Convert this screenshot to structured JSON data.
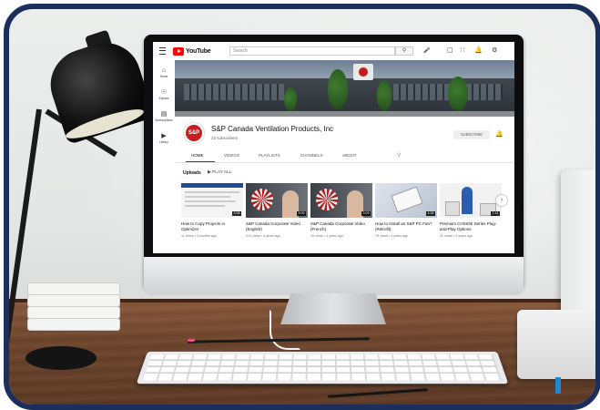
{
  "scene": {
    "frame_color": "#1c2f5c",
    "desk_color": "#6e452c"
  },
  "youtube": {
    "logo_text": "YouTube",
    "search_placeholder": "Search",
    "sidebar": [
      {
        "icon": "home-icon",
        "label": "Home"
      },
      {
        "icon": "explore-icon",
        "label": "Explore"
      },
      {
        "icon": "subscriptions-icon",
        "label": "Subscriptions"
      },
      {
        "icon": "library-icon",
        "label": "Library"
      }
    ],
    "channel": {
      "logo_text": "S&P",
      "name": "S&P Canada Ventilation Products, Inc",
      "subscribers": "22 subscribers",
      "subscribe_label": "SUBSCRIBE"
    },
    "tabs": [
      "HOME",
      "VIDEOS",
      "PLAYLISTS",
      "CHANNELS",
      "ABOUT"
    ],
    "uploads_label": "Uploads",
    "play_all_label": "PLAY ALL",
    "videos": [
      {
        "title": "How to Copy Projects in Optimizer",
        "meta": "11 views • 3 months ago",
        "duration": "3:38"
      },
      {
        "title": "S&P Canada Corporate Video (English)",
        "meta": "214 views • 4 years ago",
        "duration": "3:09"
      },
      {
        "title": "S&P Canada Corporate Video (French)",
        "meta": "16 views • 4 years ago",
        "duration": "3:09"
      },
      {
        "title": "How to Install an S&P PC Fan? (Retrofit)",
        "meta": "78 views • 4 years ago",
        "duration": "4:26"
      },
      {
        "title": "Premium CHSIOE Series Plug-and-Play Options",
        "meta": "32 views • 4 years ago",
        "duration": "1:11"
      }
    ]
  }
}
